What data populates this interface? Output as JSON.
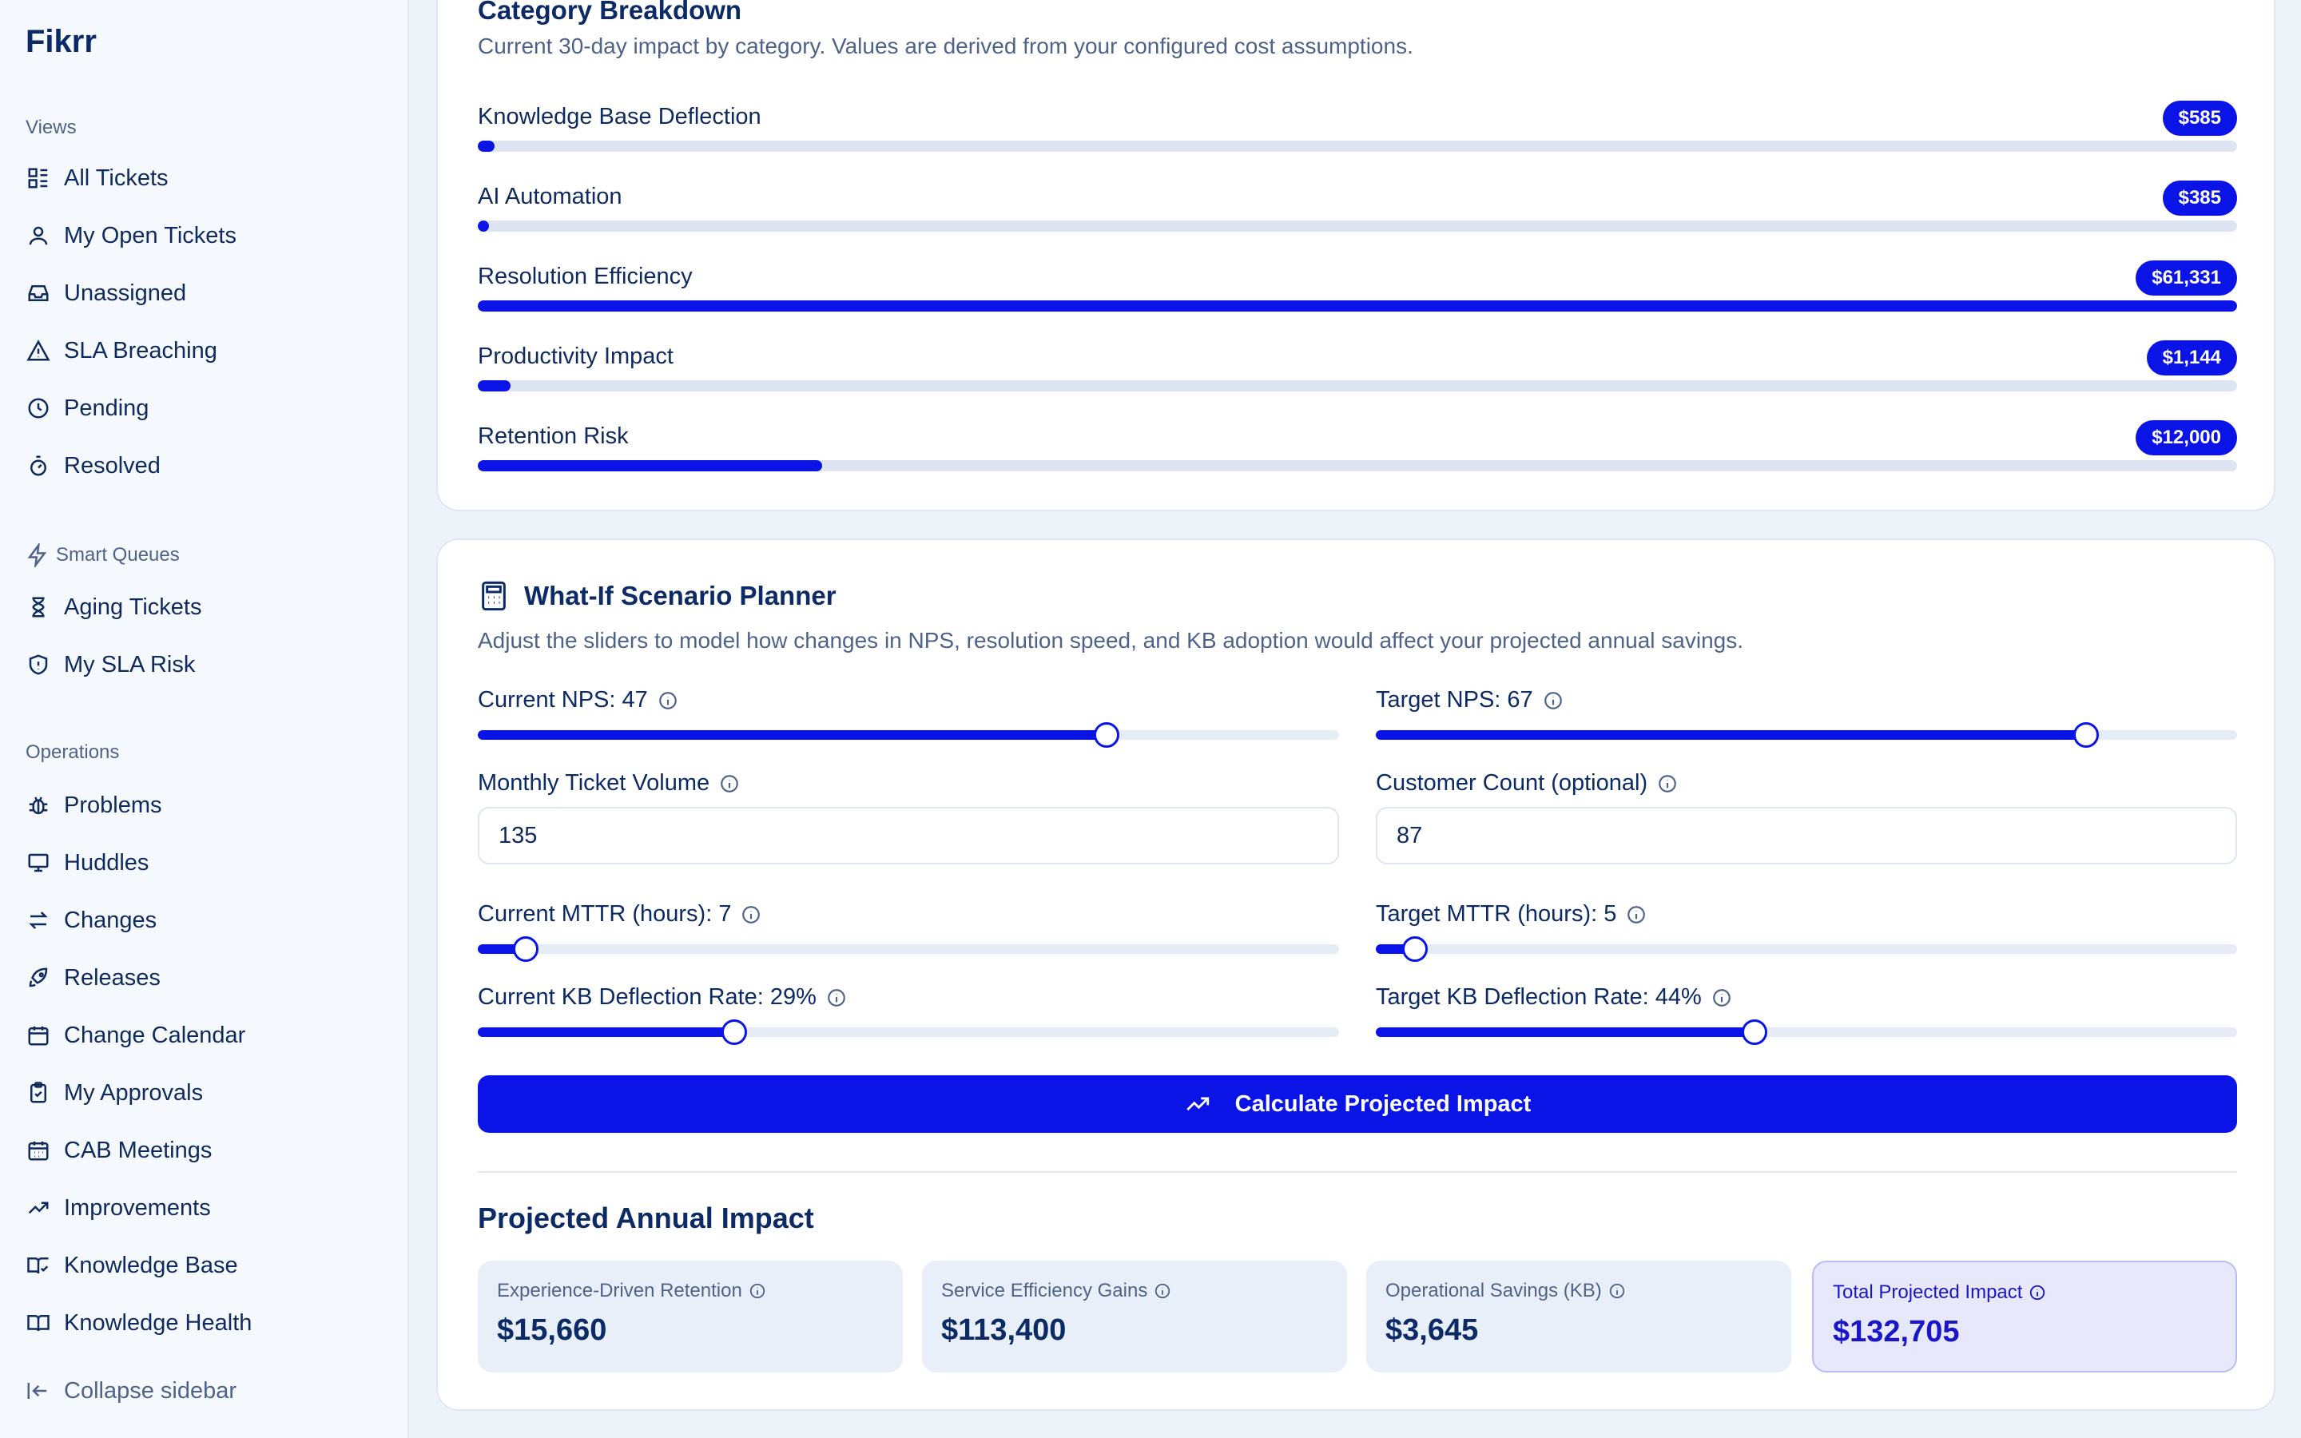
{
  "app": {
    "name": "Fikrr"
  },
  "sidebar": {
    "views_label": "Views",
    "views": [
      {
        "label": "All Tickets",
        "icon": "list-icon"
      },
      {
        "label": "My Open Tickets",
        "icon": "user-icon"
      },
      {
        "label": "Unassigned",
        "icon": "inbox-icon"
      },
      {
        "label": "SLA Breaching",
        "icon": "alert-triangle-icon"
      },
      {
        "label": "Pending",
        "icon": "clock-icon"
      },
      {
        "label": "Resolved",
        "icon": "timer-icon"
      }
    ],
    "smart_label": "Smart Queues",
    "smart": [
      {
        "label": "Aging Tickets",
        "icon": "hourglass-icon"
      },
      {
        "label": "My SLA Risk",
        "icon": "shield-icon"
      }
    ],
    "ops_label": "Operations",
    "ops": [
      {
        "label": "Problems",
        "icon": "bug-icon"
      },
      {
        "label": "Huddles",
        "icon": "monitor-icon"
      },
      {
        "label": "Changes",
        "icon": "swap-icon"
      },
      {
        "label": "Releases",
        "icon": "rocket-icon"
      },
      {
        "label": "Change Calendar",
        "icon": "calendar-icon"
      },
      {
        "label": "My Approvals",
        "icon": "clipboard-check-icon"
      },
      {
        "label": "CAB Meetings",
        "icon": "calendar-grid-icon"
      },
      {
        "label": "Improvements",
        "icon": "trending-up-icon"
      },
      {
        "label": "Knowledge Base",
        "icon": "book-open-check-icon"
      },
      {
        "label": "Knowledge Health",
        "icon": "book-open-icon"
      }
    ],
    "collapse_label": "Collapse sidebar"
  },
  "category": {
    "title": "Category Breakdown",
    "subtitle": "Current 30-day impact by category. Values are derived from your configured cost assumptions.",
    "rows": [
      {
        "label": "Knowledge Base Deflection",
        "value": "$585",
        "fraction": 0.0095
      },
      {
        "label": "AI Automation",
        "value": "$385",
        "fraction": 0.0063
      },
      {
        "label": "Resolution Efficiency",
        "value": "$61,331",
        "fraction": 1.0
      },
      {
        "label": "Productivity Impact",
        "value": "$1,144",
        "fraction": 0.0187
      },
      {
        "label": "Retention Risk",
        "value": "$12,000",
        "fraction": 0.1957
      }
    ]
  },
  "whatif": {
    "title": "What-If Scenario Planner",
    "subtitle": "Adjust the sliders to model how changes in NPS, resolution speed, and KB adoption would affect your projected annual savings.",
    "current_nps": {
      "label": "Current NPS: 47",
      "fraction": 0.73
    },
    "target_nps": {
      "label": "Target NPS: 67",
      "fraction": 0.825
    },
    "ticket_volume": {
      "label": "Monthly Ticket Volume",
      "value": "135"
    },
    "customer_count": {
      "label": "Customer Count (optional)",
      "value": "87"
    },
    "current_mttr": {
      "label": "Current MTTR (hours): 7",
      "fraction": 0.056
    },
    "target_mttr": {
      "label": "Target MTTR (hours): 5",
      "fraction": 0.045
    },
    "current_kb": {
      "label": "Current KB Deflection Rate: 29%",
      "fraction": 0.298
    },
    "target_kb": {
      "label": "Target KB Deflection Rate: 44%",
      "fraction": 0.44
    },
    "calculate_label": "Calculate Projected Impact"
  },
  "projected": {
    "title": "Projected Annual Impact",
    "metrics": [
      {
        "label": "Experience-Driven Retention",
        "value": "$15,660"
      },
      {
        "label": "Service Efficiency Gains",
        "value": "$113,400"
      },
      {
        "label": "Operational Savings (KB)",
        "value": "$3,645"
      },
      {
        "label": "Total Projected Impact",
        "value": "$132,705"
      }
    ]
  },
  "colors": {
    "accent": "#0a14e6",
    "text": "#0b2a66",
    "muted": "#4f638a"
  }
}
